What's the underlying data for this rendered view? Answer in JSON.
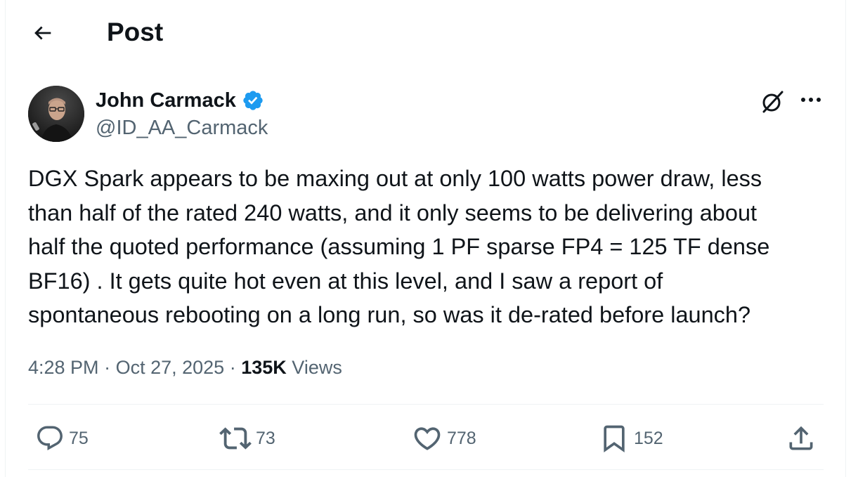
{
  "header": {
    "title": "Post",
    "back_icon": "back-arrow-icon"
  },
  "author": {
    "display_name": "John Carmack",
    "handle": "@ID_AA_Carmack",
    "verified": true,
    "verified_color": "#1d9bf0"
  },
  "tweet": {
    "text": "DGX Spark appears to be maxing out at only 100 watts power draw, less\nthan half of the rated 240 watts, and it only seems to be delivering about\nhalf the quoted performance (assuming 1 PF sparse FP4 = 125 TF dense\nBF16) . It gets quite hot even at this level, and I saw a report of\nspontaneous rebooting on a long run, so was it de-rated before launch?",
    "time": "4:28 PM",
    "date": "Oct 27, 2025",
    "separator": "·",
    "views_count": "135K",
    "views_label": "Views"
  },
  "actions": {
    "replies": "75",
    "reposts": "73",
    "likes": "778",
    "bookmarks": "152"
  },
  "colors": {
    "text": "#0f1419",
    "secondary": "#536471",
    "border": "#eff3f4"
  }
}
